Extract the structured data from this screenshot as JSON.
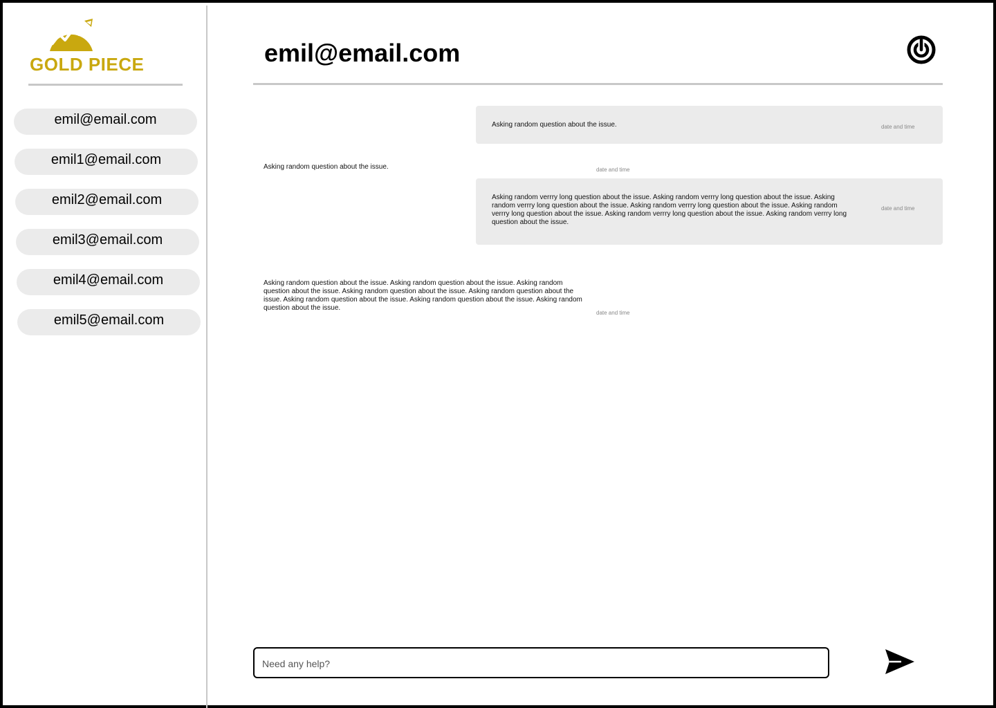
{
  "brand": {
    "name": "GOLD PIECE",
    "color": "#c9a80f",
    "icon": "coin-trend-icon"
  },
  "sidebar": {
    "contacts": [
      {
        "email": "emil@email.com"
      },
      {
        "email": "emil1@email.com"
      },
      {
        "email": "emil2@email.com"
      },
      {
        "email": "emil3@email.com"
      },
      {
        "email": "emil4@email.com"
      },
      {
        "email": "emil5@email.com"
      }
    ]
  },
  "header": {
    "title": "emil@email.com",
    "power_icon": "power-icon"
  },
  "messages": [
    {
      "side": "right",
      "text": "Asking random question about the issue.",
      "time": "date and time"
    },
    {
      "side": "left",
      "text": "Asking random question about the issue.",
      "time": "date and time"
    },
    {
      "side": "right",
      "text": "Asking random  verrry long question about the issue. Asking random  verrry long question about the issue. Asking random  verrry long question about the issue. Asking random  verrry long question about the issue. Asking random  verrry long question about the issue. Asking random  verrry long question about the issue. Asking random  verrry long question about the issue.",
      "time": "date and time"
    },
    {
      "side": "left",
      "text": "Asking random question about the issue. Asking random question about the issue. Asking random question about the issue. Asking random question about the issue. Asking random question about the issue. Asking random question about the issue. Asking random question about the issue. Asking random question about the issue.",
      "time": "date and time"
    }
  ],
  "composer": {
    "placeholder": "Need any help?",
    "send_icon": "send-icon"
  },
  "colors": {
    "bubble": "#ebebeb",
    "divider": "#c8c8c8",
    "accent": "#c9a80f"
  }
}
